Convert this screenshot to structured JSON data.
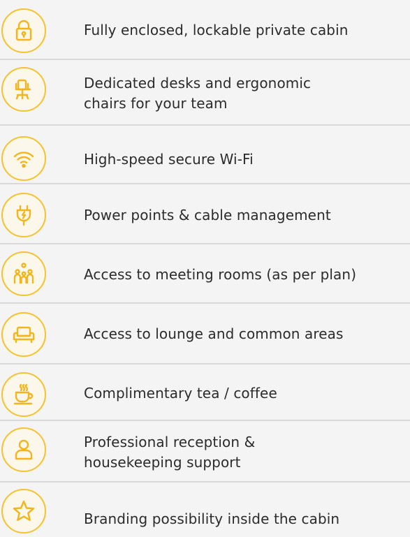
{
  "features": [
    {
      "icon": "lock-icon",
      "lines": [
        "Fully enclosed, lockable private cabin"
      ]
    },
    {
      "icon": "desk-chair-icon",
      "lines": [
        "Dedicated desks and ergonomic",
        "chairs for your team"
      ]
    },
    {
      "icon": "wifi-icon",
      "lines": [
        "High-speed secure Wi-Fi"
      ]
    },
    {
      "icon": "power-plug-icon",
      "lines": [
        "Power points & cable management"
      ]
    },
    {
      "icon": "meeting-people-icon",
      "lines": [
        "Access to meeting rooms (as per plan)"
      ]
    },
    {
      "icon": "sofa-icon",
      "lines": [
        "Access to lounge and common areas"
      ]
    },
    {
      "icon": "coffee-cup-icon",
      "lines": [
        "Complimentary tea / coffee"
      ]
    },
    {
      "icon": "reception-person-icon",
      "lines": [
        "Professional reception &",
        "housekeeping support"
      ]
    },
    {
      "icon": "star-icon",
      "lines": [
        "Branding possibility inside the cabin"
      ]
    }
  ],
  "colors": {
    "accent": "#f5c232",
    "icon_stroke": "#f2b61c",
    "text": "#2b2b2b",
    "background": "#f4f4f4",
    "divider": "#d9d9d9"
  }
}
